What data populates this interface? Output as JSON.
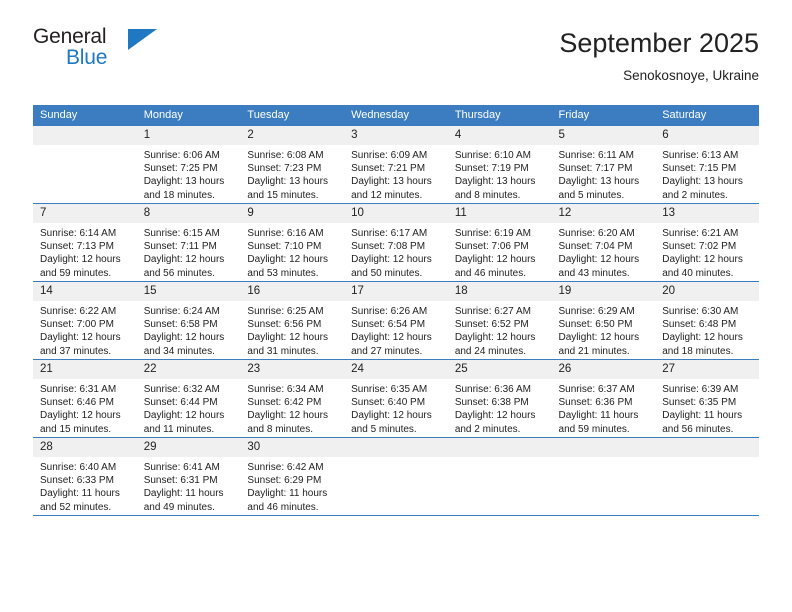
{
  "brand": {
    "line1": "General",
    "line2": "Blue",
    "triangle_color": "#1f78c1"
  },
  "header": {
    "title": "September 2025",
    "subtitle": "Senokosnoye, Ukraine"
  },
  "theme": {
    "header_bg": "#3b7dc0",
    "daynum_bg": "#f0f0f0",
    "text": "#222222"
  },
  "calendar": {
    "weekday_headers": [
      "Sunday",
      "Monday",
      "Tuesday",
      "Wednesday",
      "Thursday",
      "Friday",
      "Saturday"
    ],
    "weeks": [
      [
        {
          "day": "",
          "sunrise": "",
          "sunset": "",
          "daylight": "",
          "empty": true
        },
        {
          "day": "1",
          "sunrise": "Sunrise: 6:06 AM",
          "sunset": "Sunset: 7:25 PM",
          "daylight": "Daylight: 13 hours and 18 minutes."
        },
        {
          "day": "2",
          "sunrise": "Sunrise: 6:08 AM",
          "sunset": "Sunset: 7:23 PM",
          "daylight": "Daylight: 13 hours and 15 minutes."
        },
        {
          "day": "3",
          "sunrise": "Sunrise: 6:09 AM",
          "sunset": "Sunset: 7:21 PM",
          "daylight": "Daylight: 13 hours and 12 minutes."
        },
        {
          "day": "4",
          "sunrise": "Sunrise: 6:10 AM",
          "sunset": "Sunset: 7:19 PM",
          "daylight": "Daylight: 13 hours and 8 minutes."
        },
        {
          "day": "5",
          "sunrise": "Sunrise: 6:11 AM",
          "sunset": "Sunset: 7:17 PM",
          "daylight": "Daylight: 13 hours and 5 minutes."
        },
        {
          "day": "6",
          "sunrise": "Sunrise: 6:13 AM",
          "sunset": "Sunset: 7:15 PM",
          "daylight": "Daylight: 13 hours and 2 minutes."
        }
      ],
      [
        {
          "day": "7",
          "sunrise": "Sunrise: 6:14 AM",
          "sunset": "Sunset: 7:13 PM",
          "daylight": "Daylight: 12 hours and 59 minutes."
        },
        {
          "day": "8",
          "sunrise": "Sunrise: 6:15 AM",
          "sunset": "Sunset: 7:11 PM",
          "daylight": "Daylight: 12 hours and 56 minutes."
        },
        {
          "day": "9",
          "sunrise": "Sunrise: 6:16 AM",
          "sunset": "Sunset: 7:10 PM",
          "daylight": "Daylight: 12 hours and 53 minutes."
        },
        {
          "day": "10",
          "sunrise": "Sunrise: 6:17 AM",
          "sunset": "Sunset: 7:08 PM",
          "daylight": "Daylight: 12 hours and 50 minutes."
        },
        {
          "day": "11",
          "sunrise": "Sunrise: 6:19 AM",
          "sunset": "Sunset: 7:06 PM",
          "daylight": "Daylight: 12 hours and 46 minutes."
        },
        {
          "day": "12",
          "sunrise": "Sunrise: 6:20 AM",
          "sunset": "Sunset: 7:04 PM",
          "daylight": "Daylight: 12 hours and 43 minutes."
        },
        {
          "day": "13",
          "sunrise": "Sunrise: 6:21 AM",
          "sunset": "Sunset: 7:02 PM",
          "daylight": "Daylight: 12 hours and 40 minutes."
        }
      ],
      [
        {
          "day": "14",
          "sunrise": "Sunrise: 6:22 AM",
          "sunset": "Sunset: 7:00 PM",
          "daylight": "Daylight: 12 hours and 37 minutes."
        },
        {
          "day": "15",
          "sunrise": "Sunrise: 6:24 AM",
          "sunset": "Sunset: 6:58 PM",
          "daylight": "Daylight: 12 hours and 34 minutes."
        },
        {
          "day": "16",
          "sunrise": "Sunrise: 6:25 AM",
          "sunset": "Sunset: 6:56 PM",
          "daylight": "Daylight: 12 hours and 31 minutes."
        },
        {
          "day": "17",
          "sunrise": "Sunrise: 6:26 AM",
          "sunset": "Sunset: 6:54 PM",
          "daylight": "Daylight: 12 hours and 27 minutes."
        },
        {
          "day": "18",
          "sunrise": "Sunrise: 6:27 AM",
          "sunset": "Sunset: 6:52 PM",
          "daylight": "Daylight: 12 hours and 24 minutes."
        },
        {
          "day": "19",
          "sunrise": "Sunrise: 6:29 AM",
          "sunset": "Sunset: 6:50 PM",
          "daylight": "Daylight: 12 hours and 21 minutes."
        },
        {
          "day": "20",
          "sunrise": "Sunrise: 6:30 AM",
          "sunset": "Sunset: 6:48 PM",
          "daylight": "Daylight: 12 hours and 18 minutes."
        }
      ],
      [
        {
          "day": "21",
          "sunrise": "Sunrise: 6:31 AM",
          "sunset": "Sunset: 6:46 PM",
          "daylight": "Daylight: 12 hours and 15 minutes."
        },
        {
          "day": "22",
          "sunrise": "Sunrise: 6:32 AM",
          "sunset": "Sunset: 6:44 PM",
          "daylight": "Daylight: 12 hours and 11 minutes."
        },
        {
          "day": "23",
          "sunrise": "Sunrise: 6:34 AM",
          "sunset": "Sunset: 6:42 PM",
          "daylight": "Daylight: 12 hours and 8 minutes."
        },
        {
          "day": "24",
          "sunrise": "Sunrise: 6:35 AM",
          "sunset": "Sunset: 6:40 PM",
          "daylight": "Daylight: 12 hours and 5 minutes."
        },
        {
          "day": "25",
          "sunrise": "Sunrise: 6:36 AM",
          "sunset": "Sunset: 6:38 PM",
          "daylight": "Daylight: 12 hours and 2 minutes."
        },
        {
          "day": "26",
          "sunrise": "Sunrise: 6:37 AM",
          "sunset": "Sunset: 6:36 PM",
          "daylight": "Daylight: 11 hours and 59 minutes."
        },
        {
          "day": "27",
          "sunrise": "Sunrise: 6:39 AM",
          "sunset": "Sunset: 6:35 PM",
          "daylight": "Daylight: 11 hours and 56 minutes."
        }
      ],
      [
        {
          "day": "28",
          "sunrise": "Sunrise: 6:40 AM",
          "sunset": "Sunset: 6:33 PM",
          "daylight": "Daylight: 11 hours and 52 minutes."
        },
        {
          "day": "29",
          "sunrise": "Sunrise: 6:41 AM",
          "sunset": "Sunset: 6:31 PM",
          "daylight": "Daylight: 11 hours and 49 minutes."
        },
        {
          "day": "30",
          "sunrise": "Sunrise: 6:42 AM",
          "sunset": "Sunset: 6:29 PM",
          "daylight": "Daylight: 11 hours and 46 minutes."
        },
        {
          "day": "",
          "sunrise": "",
          "sunset": "",
          "daylight": "",
          "empty": true
        },
        {
          "day": "",
          "sunrise": "",
          "sunset": "",
          "daylight": "",
          "empty": true
        },
        {
          "day": "",
          "sunrise": "",
          "sunset": "",
          "daylight": "",
          "empty": true
        },
        {
          "day": "",
          "sunrise": "",
          "sunset": "",
          "daylight": "",
          "empty": true
        }
      ]
    ]
  }
}
